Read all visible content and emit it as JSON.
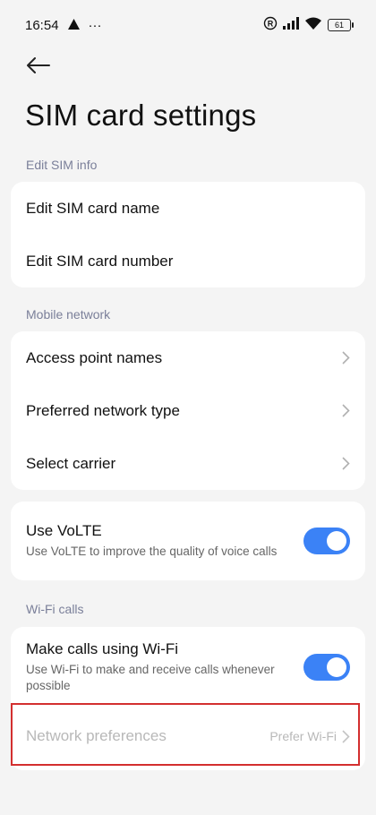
{
  "status_bar": {
    "time": "16:54",
    "extra_glyph": "···",
    "battery": "61"
  },
  "page": {
    "title": "SIM card settings"
  },
  "edit_sim_info": {
    "label": "Edit SIM info",
    "items": [
      {
        "label": "Edit SIM card name"
      },
      {
        "label": "Edit SIM card number"
      }
    ]
  },
  "mobile_network": {
    "label": "Mobile network",
    "items": [
      {
        "label": "Access point names"
      },
      {
        "label": "Preferred network type"
      },
      {
        "label": "Select carrier"
      }
    ]
  },
  "volte": {
    "title": "Use VoLTE",
    "subtitle": "Use VoLTE to improve the quality of voice calls",
    "enabled": true
  },
  "wifi_calls": {
    "label": "Wi-Fi calls",
    "toggle": {
      "title": "Make calls using Wi-Fi",
      "subtitle": "Use Wi-Fi to make and receive calls whenever possible",
      "enabled": true
    },
    "network_preferences": {
      "label": "Network preferences",
      "value": "Prefer Wi-Fi"
    }
  },
  "colors": {
    "accent": "#3b82f6",
    "highlight": "#d32f2f",
    "section": "#7a7f99"
  }
}
